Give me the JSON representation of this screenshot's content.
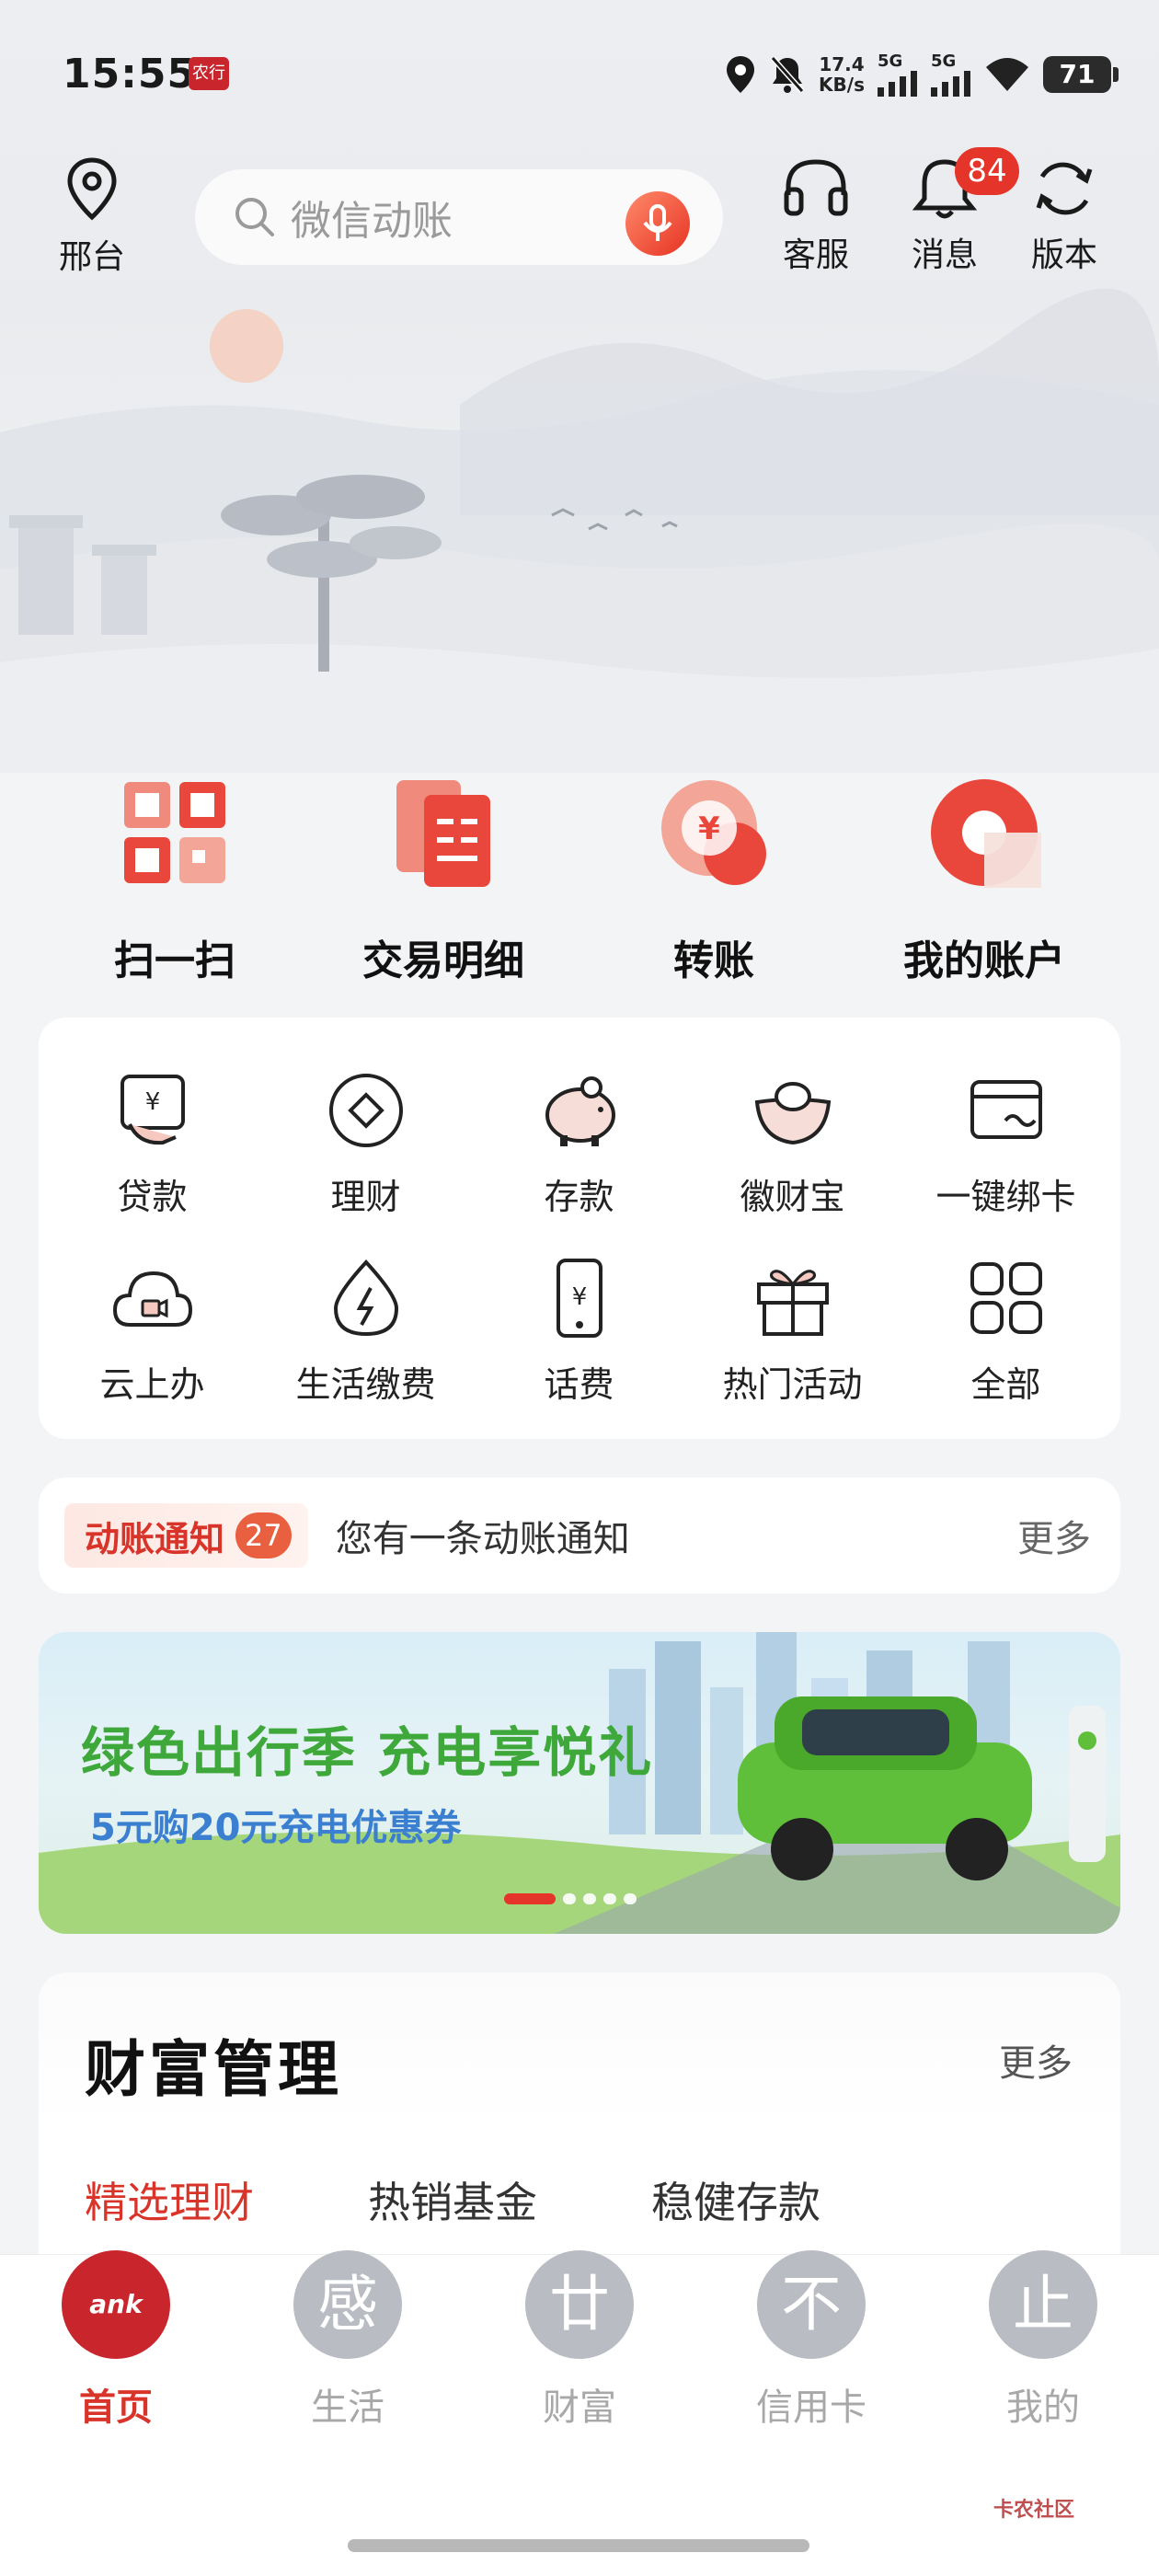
{
  "status_bar": {
    "time": "15:55",
    "app_badge": "农行",
    "net_speed_value": "17.4",
    "net_speed_unit": "KB/s",
    "signal1": "5G",
    "signal2": "5G",
    "battery": "71"
  },
  "header": {
    "location": "邢台",
    "search_placeholder": "微信动账",
    "actions": [
      {
        "label": "客服"
      },
      {
        "label": "消息",
        "badge": "84"
      },
      {
        "label": "版本"
      }
    ]
  },
  "quick_actions": [
    {
      "label": "扫一扫",
      "icon": "qr-scan-icon"
    },
    {
      "label": "交易明细",
      "icon": "document-icon"
    },
    {
      "label": "转账",
      "icon": "yuan-transfer-icon"
    },
    {
      "label": "我的账户",
      "icon": "account-icon"
    }
  ],
  "services": [
    {
      "label": "贷款",
      "icon": "loan-icon"
    },
    {
      "label": "理财",
      "icon": "diamond-icon"
    },
    {
      "label": "存款",
      "icon": "piggy-bank-icon"
    },
    {
      "label": "徽财宝",
      "icon": "gold-ingot-icon"
    },
    {
      "label": "一键绑卡",
      "icon": "card-icon"
    },
    {
      "label": "云上办",
      "icon": "cloud-video-icon"
    },
    {
      "label": "生活缴费",
      "icon": "utility-icon"
    },
    {
      "label": "话费",
      "icon": "phone-icon"
    },
    {
      "label": "热门活动",
      "icon": "gift-icon"
    },
    {
      "label": "全部",
      "icon": "grid-icon"
    }
  ],
  "notice": {
    "tag": "动账通知",
    "count": "27",
    "text": "您有一条动账通知",
    "more": "更多"
  },
  "banner": {
    "title": "绿色出行季 充电享悦礼",
    "subtitle": "5元购20元充电优惠券"
  },
  "wealth": {
    "title": "财富管理",
    "more": "更多",
    "tabs": [
      "精选理财",
      "热销基金",
      "稳健存款"
    ]
  },
  "bottom_nav": [
    {
      "label": "首页",
      "glyph": "ank",
      "active": true
    },
    {
      "label": "生活",
      "glyph": "感"
    },
    {
      "label": "财富",
      "glyph": "廿"
    },
    {
      "label": "信用卡",
      "glyph": "不"
    },
    {
      "label": "我的",
      "glyph": "止"
    }
  ],
  "watermark": "卡农社区",
  "colors": {
    "brand_red": "#d9342a",
    "accent_orange": "#e8603f",
    "banner_green": "#3fa83a",
    "banner_blue": "#3b7fd0"
  }
}
